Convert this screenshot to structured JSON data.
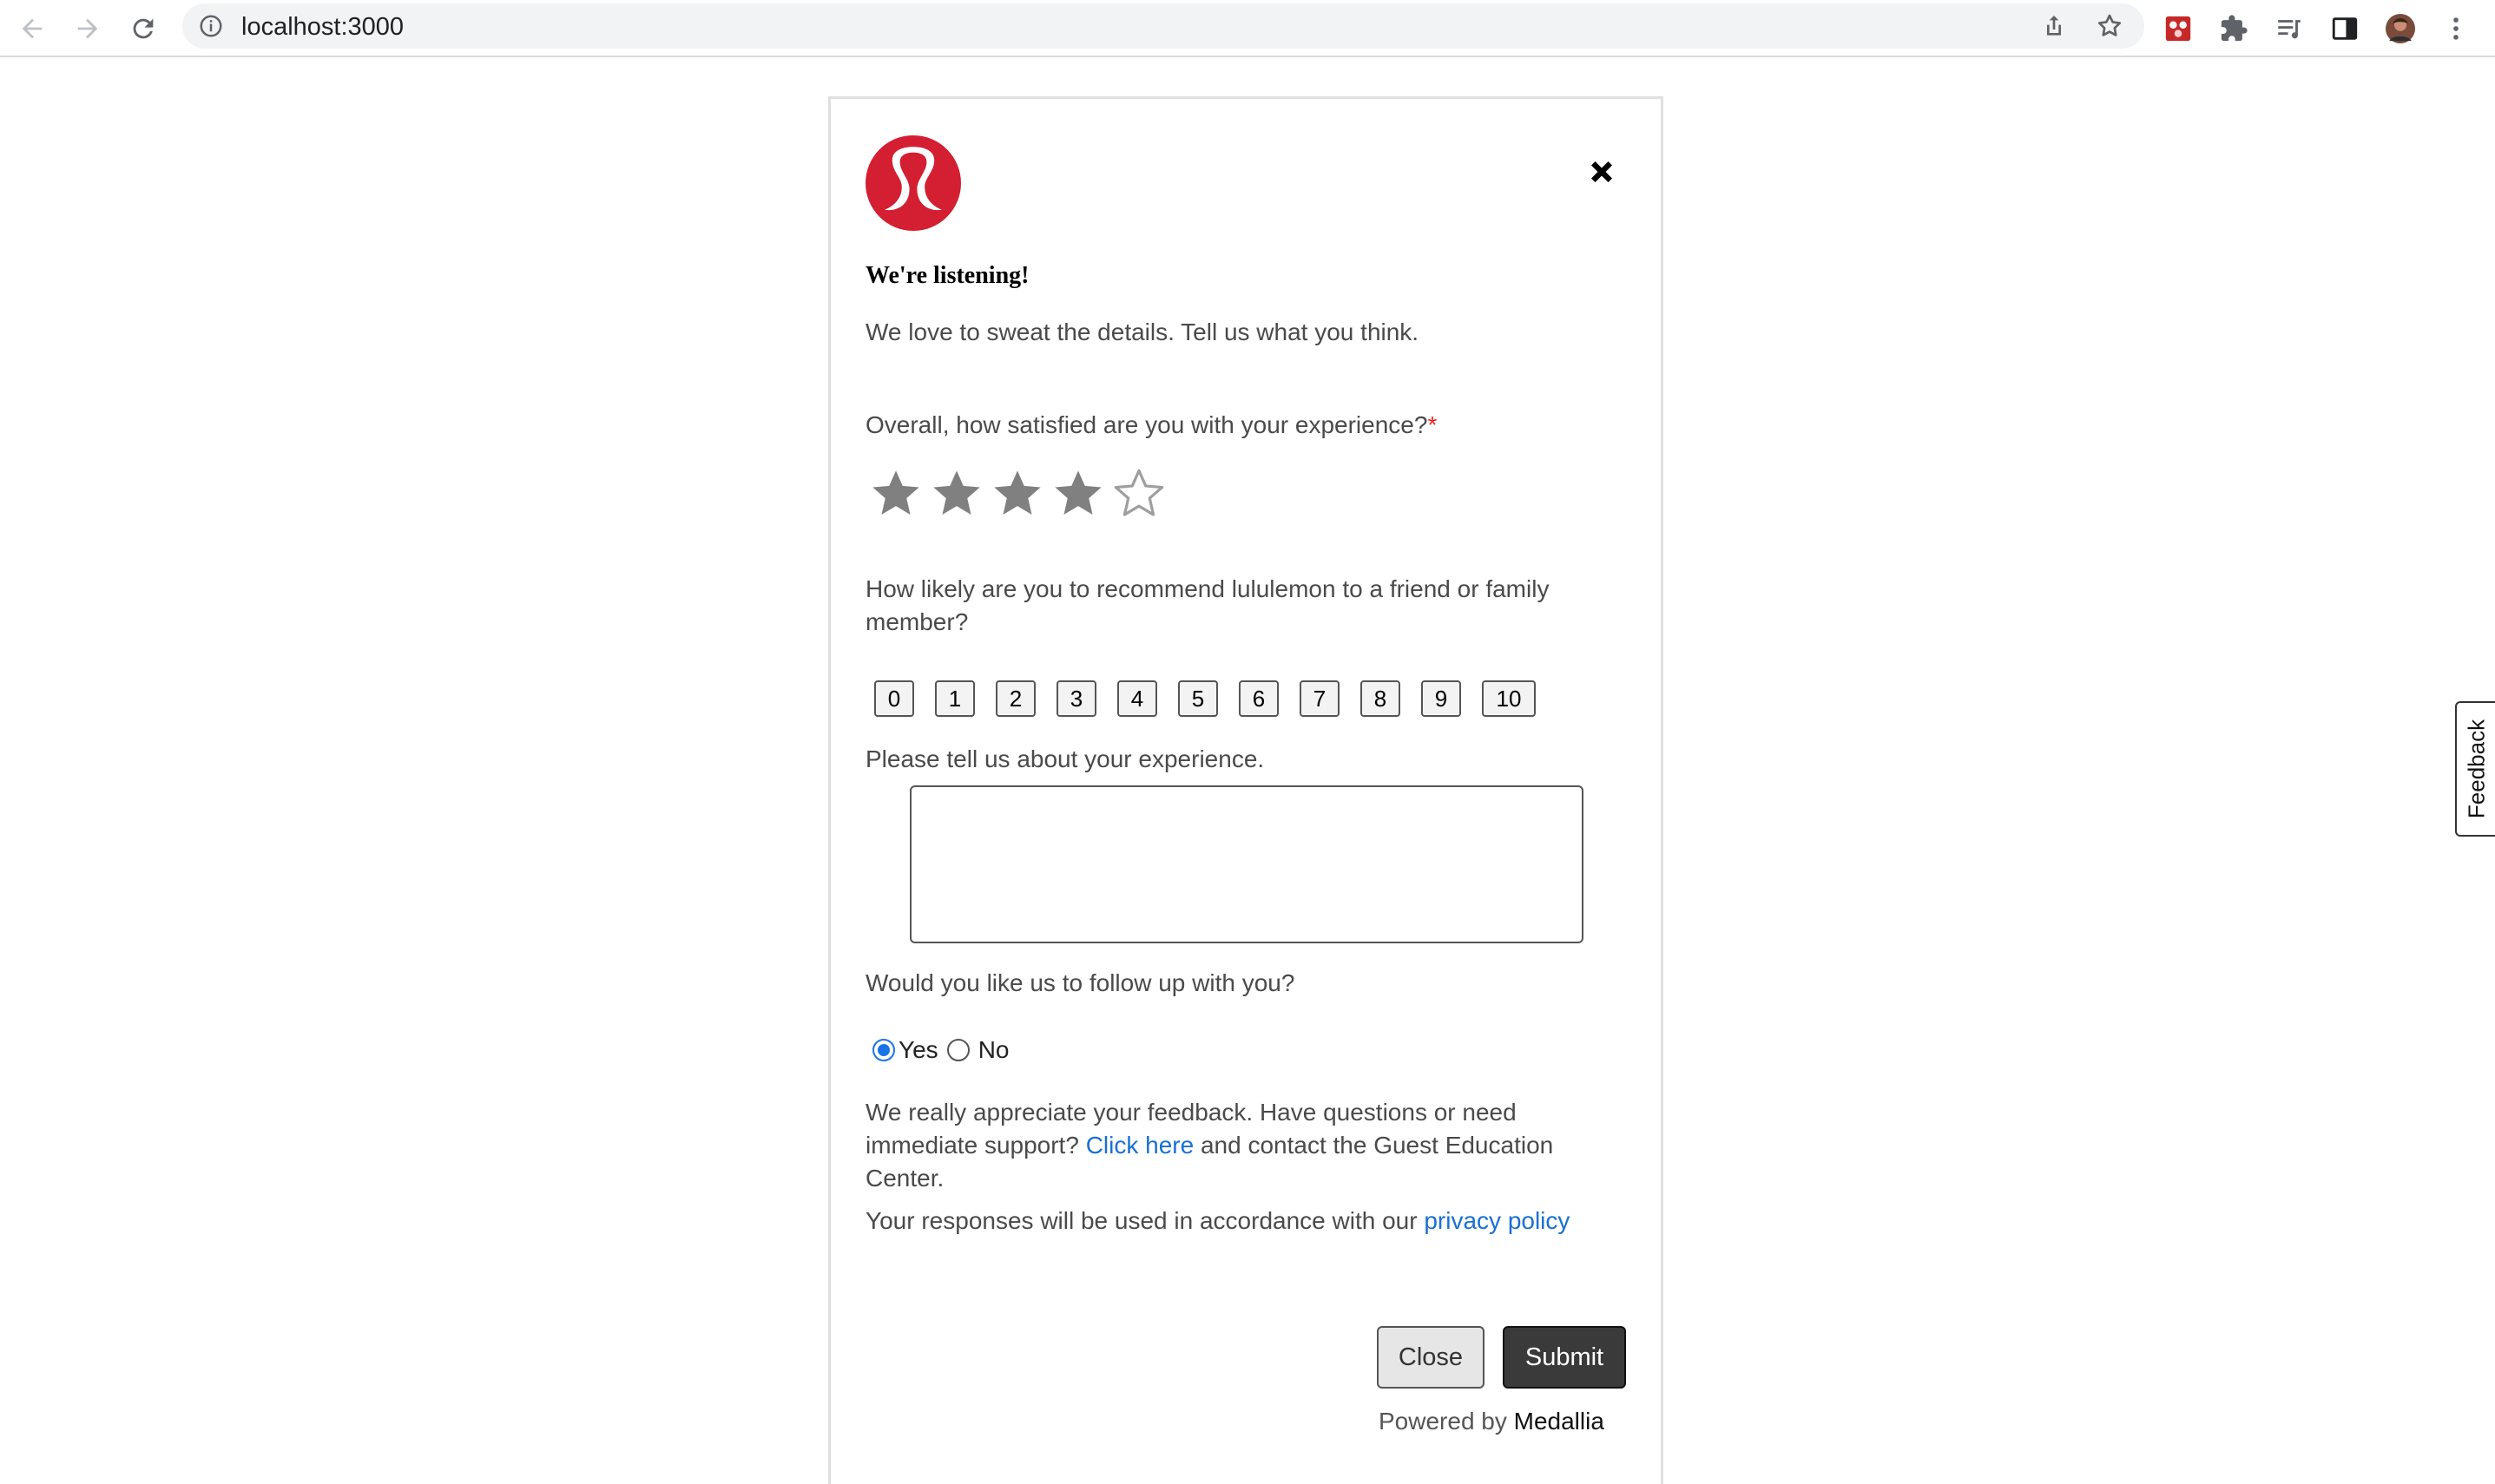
{
  "browser": {
    "url": "localhost:3000",
    "icons": [
      "back-icon",
      "forward-icon",
      "reload-icon",
      "info-icon",
      "share-icon",
      "bookmark-star-icon",
      "extension-icon",
      "puzzle-icon",
      "reading-list-icon",
      "side-panel-icon",
      "profile-avatar",
      "menu-icon"
    ]
  },
  "survey": {
    "title": "We're listening!",
    "intro": "We love to sweat the details. Tell us what you think.",
    "q1": {
      "label": "Overall, how satisfied are you with your experience?",
      "required_mark": "*",
      "rating": 4,
      "max": 5
    },
    "q2": {
      "label": "How likely are you to recommend lululemon to a friend or family member?",
      "options": [
        "0",
        "1",
        "2",
        "3",
        "4",
        "5",
        "6",
        "7",
        "8",
        "9",
        "10"
      ]
    },
    "q3": {
      "label": "Please tell us about your experience.",
      "value": ""
    },
    "q4": {
      "label": "Would you like us to follow up with you?",
      "options": [
        "Yes",
        "No"
      ],
      "selected": "Yes"
    },
    "appreciation": {
      "before": "We really appreciate your feedback. Have questions or need immediate support? ",
      "link": "Click here",
      "after": " and contact the Guest Education Center."
    },
    "privacy": {
      "before": "Your responses will be used in accordance with our ",
      "link": "privacy policy"
    },
    "buttons": {
      "close": "Close",
      "submit": "Submit"
    },
    "powered_by": {
      "prefix": "Powered by ",
      "brand": "Medallia"
    }
  },
  "feedback_tab": "Feedback",
  "colors": {
    "brand_red": "#d31f31",
    "link_blue": "#1a6fd4",
    "radio_blue": "#1a73e8",
    "star_filled": "#808080",
    "submit_bg": "#3a3a3a"
  }
}
